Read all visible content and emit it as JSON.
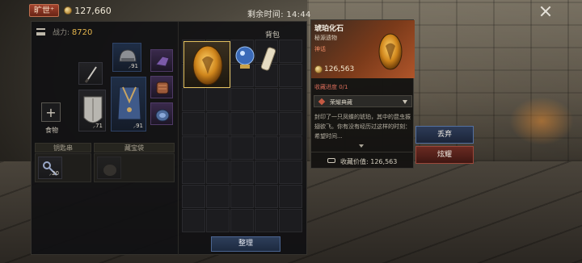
{
  "top_bar": {
    "badge": "旷世⁺",
    "coins": "127,660",
    "timer": "剩余时间: 14:44"
  },
  "inventory": {
    "power_label": "战力:",
    "power_value": "8720",
    "food_label": "食物",
    "keychain_label": "钥匙串",
    "treasure_bag_label": "藏宝袋",
    "equipment": [
      {
        "name": "helmet",
        "count": "91"
      },
      {
        "name": "chest-armor",
        "count": "91"
      },
      {
        "name": "shield",
        "count": "71"
      },
      {
        "name": "key",
        "count": "20"
      }
    ]
  },
  "bag": {
    "title": "背包",
    "sort_label": "整理"
  },
  "tooltip": {
    "name": "琥珀化石",
    "type": "秘源遗物",
    "rarity": "神话",
    "price": "126,563",
    "collection_progress": "收藏进度  0/1",
    "dropdown_value": "荣耀典藏",
    "description": "封印了一只凤蝶的琥珀，其中的昆虫振翅欲飞。你有没有经历过这样的时刻：希望时间...",
    "collection_value_label": "收藏价值:",
    "collection_value": "126,563"
  },
  "actions": {
    "discard": "丢弃",
    "show_off": "炫耀"
  },
  "colors": {
    "accent_gold": "#e3b54d",
    "mythic": "#ee8a64",
    "discard_btn": "#2d3b57",
    "show_btn": "#6a2a22"
  }
}
